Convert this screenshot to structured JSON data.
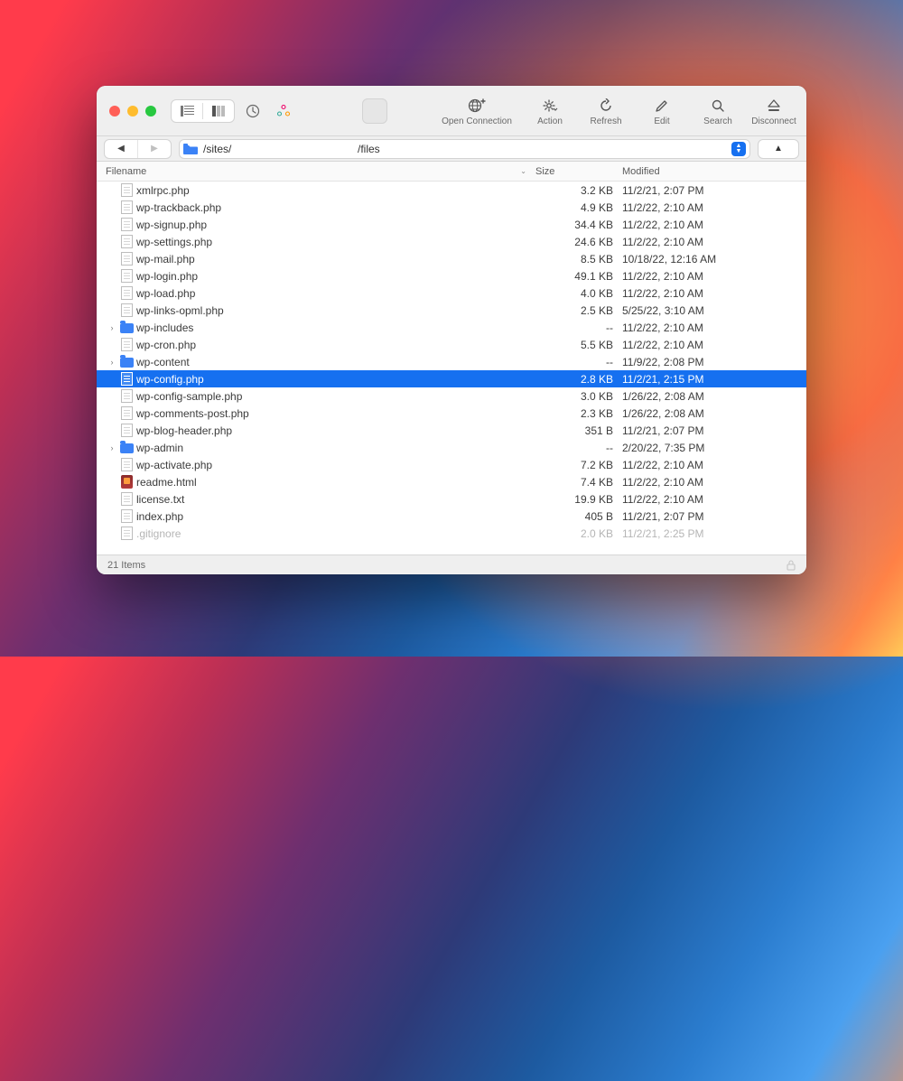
{
  "toolbar": {
    "open_connection": "Open Connection",
    "action": "Action",
    "refresh": "Refresh",
    "edit": "Edit",
    "search": "Search",
    "disconnect": "Disconnect"
  },
  "path": {
    "segment1": "/sites/",
    "segment2": "/files"
  },
  "columns": {
    "filename": "Filename",
    "size": "Size",
    "modified": "Modified"
  },
  "files": [
    {
      "type": "file",
      "name": "xmlrpc.php",
      "size": "3.2 KB",
      "modified": "11/2/21, 2:07 PM"
    },
    {
      "type": "file",
      "name": "wp-trackback.php",
      "size": "4.9 KB",
      "modified": "11/2/22, 2:10 AM"
    },
    {
      "type": "file",
      "name": "wp-signup.php",
      "size": "34.4 KB",
      "modified": "11/2/22, 2:10 AM"
    },
    {
      "type": "file",
      "name": "wp-settings.php",
      "size": "24.6 KB",
      "modified": "11/2/22, 2:10 AM"
    },
    {
      "type": "file",
      "name": "wp-mail.php",
      "size": "8.5 KB",
      "modified": "10/18/22, 12:16 AM"
    },
    {
      "type": "file",
      "name": "wp-login.php",
      "size": "49.1 KB",
      "modified": "11/2/22, 2:10 AM"
    },
    {
      "type": "file",
      "name": "wp-load.php",
      "size": "4.0 KB",
      "modified": "11/2/22, 2:10 AM"
    },
    {
      "type": "file",
      "name": "wp-links-opml.php",
      "size": "2.5 KB",
      "modified": "5/25/22, 3:10 AM"
    },
    {
      "type": "folder",
      "expandable": true,
      "name": "wp-includes",
      "size": "--",
      "modified": "11/2/22, 2:10 AM"
    },
    {
      "type": "file",
      "name": "wp-cron.php",
      "size": "5.5 KB",
      "modified": "11/2/22, 2:10 AM"
    },
    {
      "type": "folder",
      "expandable": true,
      "name": "wp-content",
      "size": "--",
      "modified": "11/9/22, 2:08 PM"
    },
    {
      "type": "file",
      "selected": true,
      "name": "wp-config.php",
      "size": "2.8 KB",
      "modified": "11/2/21, 2:15 PM"
    },
    {
      "type": "file",
      "name": "wp-config-sample.php",
      "size": "3.0 KB",
      "modified": "1/26/22, 2:08 AM"
    },
    {
      "type": "file",
      "name": "wp-comments-post.php",
      "size": "2.3 KB",
      "modified": "1/26/22, 2:08 AM"
    },
    {
      "type": "file",
      "name": "wp-blog-header.php",
      "size": "351 B",
      "modified": "11/2/21, 2:07 PM"
    },
    {
      "type": "folder",
      "expandable": true,
      "name": "wp-admin",
      "size": "--",
      "modified": "2/20/22, 7:35 PM"
    },
    {
      "type": "file",
      "name": "wp-activate.php",
      "size": "7.2 KB",
      "modified": "11/2/22, 2:10 AM"
    },
    {
      "type": "html",
      "name": "readme.html",
      "size": "7.4 KB",
      "modified": "11/2/22, 2:10 AM"
    },
    {
      "type": "file",
      "name": "license.txt",
      "size": "19.9 KB",
      "modified": "11/2/22, 2:10 AM"
    },
    {
      "type": "file",
      "name": "index.php",
      "size": "405 B",
      "modified": "11/2/21, 2:07 PM"
    },
    {
      "type": "file",
      "dim": true,
      "name": ".gitignore",
      "size": "2.0 KB",
      "modified": "11/2/21, 2:25 PM"
    }
  ],
  "status": {
    "count": "21 Items"
  }
}
